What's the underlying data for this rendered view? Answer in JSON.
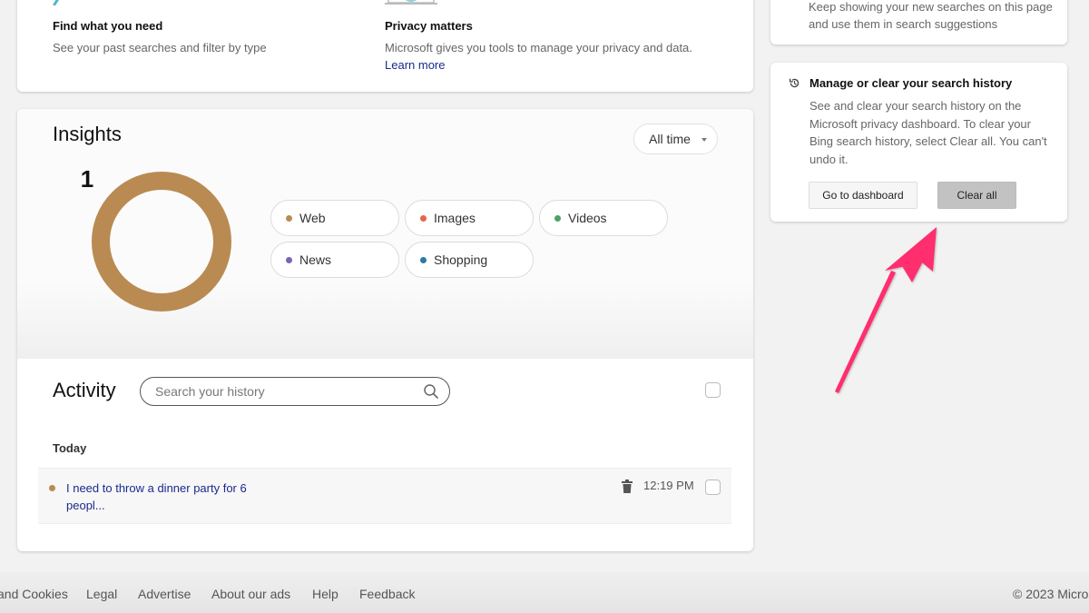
{
  "features": [
    {
      "title": "Find what you need",
      "description": "See your past searches and filter by type",
      "icon": "magnifier-illustration"
    },
    {
      "title": "Privacy matters",
      "description": "Microsoft gives you tools to manage your privacy and data.",
      "link": "Learn more",
      "icon": "laptop-shield-illustration"
    }
  ],
  "keep_card": {
    "text": "Keep showing your new searches on this page and use them in search suggestions"
  },
  "manage_card": {
    "icon": "history-icon",
    "title": "Manage or clear your search history",
    "description": "See and clear your search history on the Microsoft privacy dashboard. To clear your Bing search history, select Clear all. You can't undo it.",
    "dashboard_button": "Go to dashboard",
    "clear_button": "Clear all"
  },
  "insights": {
    "title": "Insights",
    "time_filter": "All time",
    "total": "1",
    "categories": [
      {
        "label": "Web",
        "color": "#b98b52",
        "count": 1
      },
      {
        "label": "Images",
        "color": "#e5664a",
        "count": 0
      },
      {
        "label": "Videos",
        "color": "#4aa264",
        "count": 0
      },
      {
        "label": "News",
        "color": "#7a63b5",
        "count": 0
      },
      {
        "label": "Shopping",
        "color": "#2a7ca6",
        "count": 0
      }
    ]
  },
  "activity": {
    "title": "Activity",
    "search_placeholder": "Search your history",
    "search_value": "",
    "group_label": "Today",
    "items": [
      {
        "text": "I need to throw a dinner party for 6 peopl...",
        "time": "12:19 PM",
        "category_color": "#b98b52"
      }
    ]
  },
  "footer": {
    "links": [
      "and Cookies",
      "Legal",
      "Advertise",
      "About our ads",
      "Help",
      "Feedback"
    ],
    "copyright": "© 2023 Micro"
  },
  "annotation": {
    "arrow_color": "#ff2f6e",
    "target": "Clear all"
  }
}
